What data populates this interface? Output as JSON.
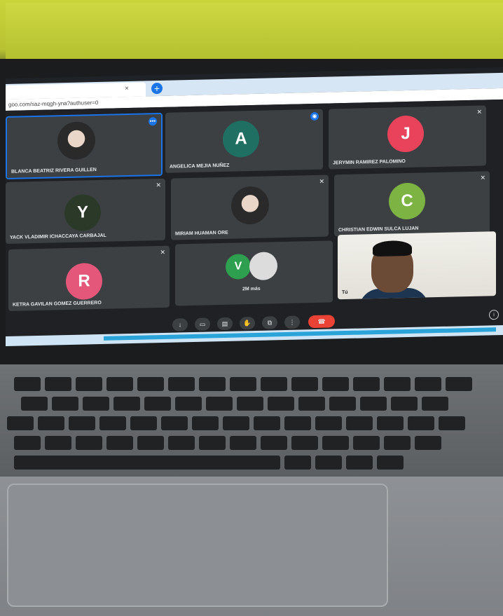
{
  "browser": {
    "tab_close": "×",
    "new_tab": "+",
    "url": "goo.com/saz-mqgh-yna?authuser=0"
  },
  "tiles": [
    {
      "name": "BLANCA BEATRIZ RIVERA GUILLEN",
      "type": "photo"
    },
    {
      "name": "ANGELICA MEJIA NUÑEZ",
      "type": "initial",
      "initial": "A",
      "color": "#1f6f63"
    },
    {
      "name": "JERYMIN RAMIREZ PALOMINO",
      "type": "initial",
      "initial": "J",
      "color": "#e8435a"
    },
    {
      "name": "YACK VLADIMIR ICHACCAYA CARBAJAL",
      "type": "initial",
      "initial": "Y",
      "color": "#2b3a28"
    },
    {
      "name": "MIRIAM HUAMAN ORE",
      "type": "photo"
    },
    {
      "name": "CHRISTIAN EDWIN SULCA LUJAN",
      "type": "initial",
      "initial": "C",
      "color": "#7cb342"
    },
    {
      "name": "KETRA GAVILAN GOMEZ GUERRERO",
      "type": "initial",
      "initial": "R",
      "color": "#e5577a"
    },
    {
      "name": "2M más",
      "type": "group",
      "initial": "V",
      "color": "#2e9e4f"
    },
    {
      "name": "Tú",
      "type": "self"
    }
  ],
  "controls": [
    "↓",
    "▭",
    "▤",
    "✋",
    "⧉",
    "⋮",
    "☎"
  ]
}
